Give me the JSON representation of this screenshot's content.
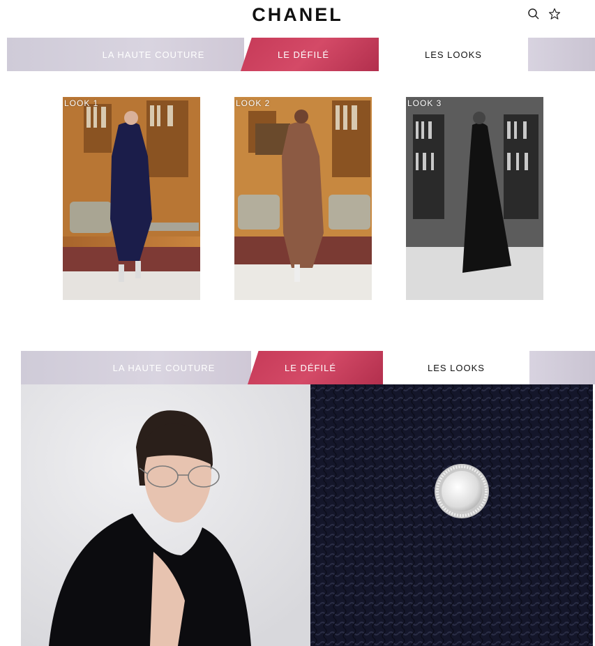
{
  "header": {
    "logo": "CHANEL",
    "icons": [
      "search-icon",
      "star-icon"
    ]
  },
  "nav_top": {
    "tabs": [
      {
        "label": "LA HAUTE COUTURE"
      },
      {
        "label": "LE DÉFILÉ"
      },
      {
        "label": "LES LOOKS",
        "active": true
      }
    ]
  },
  "looks": [
    {
      "label": "LOOK 1",
      "image": "model in navy tweed coat in library"
    },
    {
      "label": "LOOK 2",
      "image": "model in brown tweed long coat in library"
    },
    {
      "label": "LOOK 3",
      "image": "black and white model in long black coat"
    }
  ],
  "nav_bottom": {
    "tabs": [
      {
        "label": "LA HAUTE COUTURE"
      },
      {
        "label": "LE DÉFILÉ"
      },
      {
        "label": "LES LOOKS",
        "active": true
      }
    ]
  },
  "colors": {
    "accent_red": "#c63a58",
    "lavender": "#d4cfdc",
    "navy_fabric": "#151728"
  }
}
